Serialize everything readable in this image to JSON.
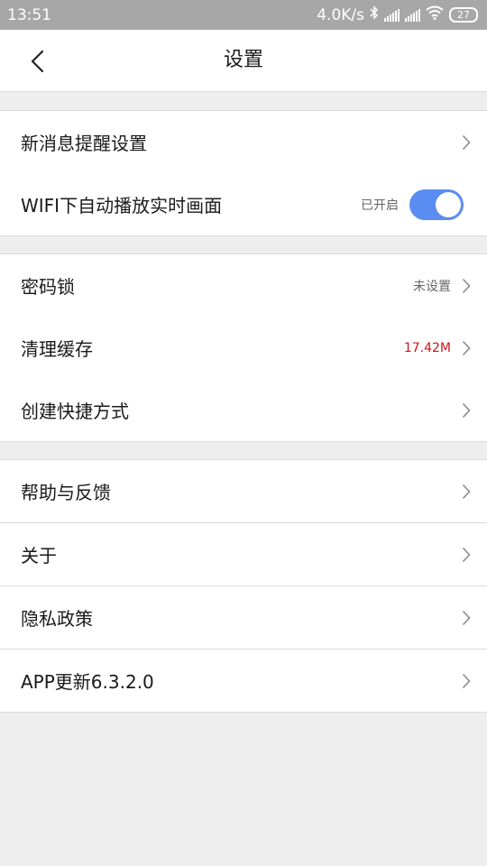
{
  "status_bar": {
    "time": "13:51",
    "network_speed": "4.0K/s",
    "battery": "27",
    "icons": [
      "bluetooth-icon",
      "signal-icon",
      "signal-icon",
      "wifi-icon",
      "battery-icon"
    ]
  },
  "header": {
    "title": "设置",
    "back_icon": "chevron-left-icon"
  },
  "groups": [
    {
      "items": [
        {
          "label": "新消息提醒设置",
          "value": "",
          "control": "chevron"
        },
        {
          "label": "WIFI下自动播放实时画面",
          "value": "已开启",
          "control": "toggle",
          "toggle_on": true,
          "toggle_color": "#5b8cf1"
        }
      ]
    },
    {
      "items": [
        {
          "label": "密码锁",
          "value": "未设置",
          "control": "chevron"
        },
        {
          "label": "清理缓存",
          "value": "17.42M",
          "value_color": "#d0121b",
          "control": "chevron"
        },
        {
          "label": "创建快捷方式",
          "value": "",
          "control": "chevron"
        }
      ]
    },
    {
      "items": [
        {
          "label": "帮助与反馈",
          "value": "",
          "control": "chevron"
        },
        {
          "label": "关于",
          "value": "",
          "control": "chevron"
        },
        {
          "label": "隐私政策",
          "value": "",
          "control": "chevron"
        },
        {
          "label": "APP更新6.3.2.0",
          "value": "",
          "control": "chevron"
        }
      ]
    }
  ],
  "colors": {
    "background": "#efeeef",
    "status_bar": "#a7a7a7",
    "accent": "#5b8cf1",
    "alert_text": "#d0121b"
  }
}
